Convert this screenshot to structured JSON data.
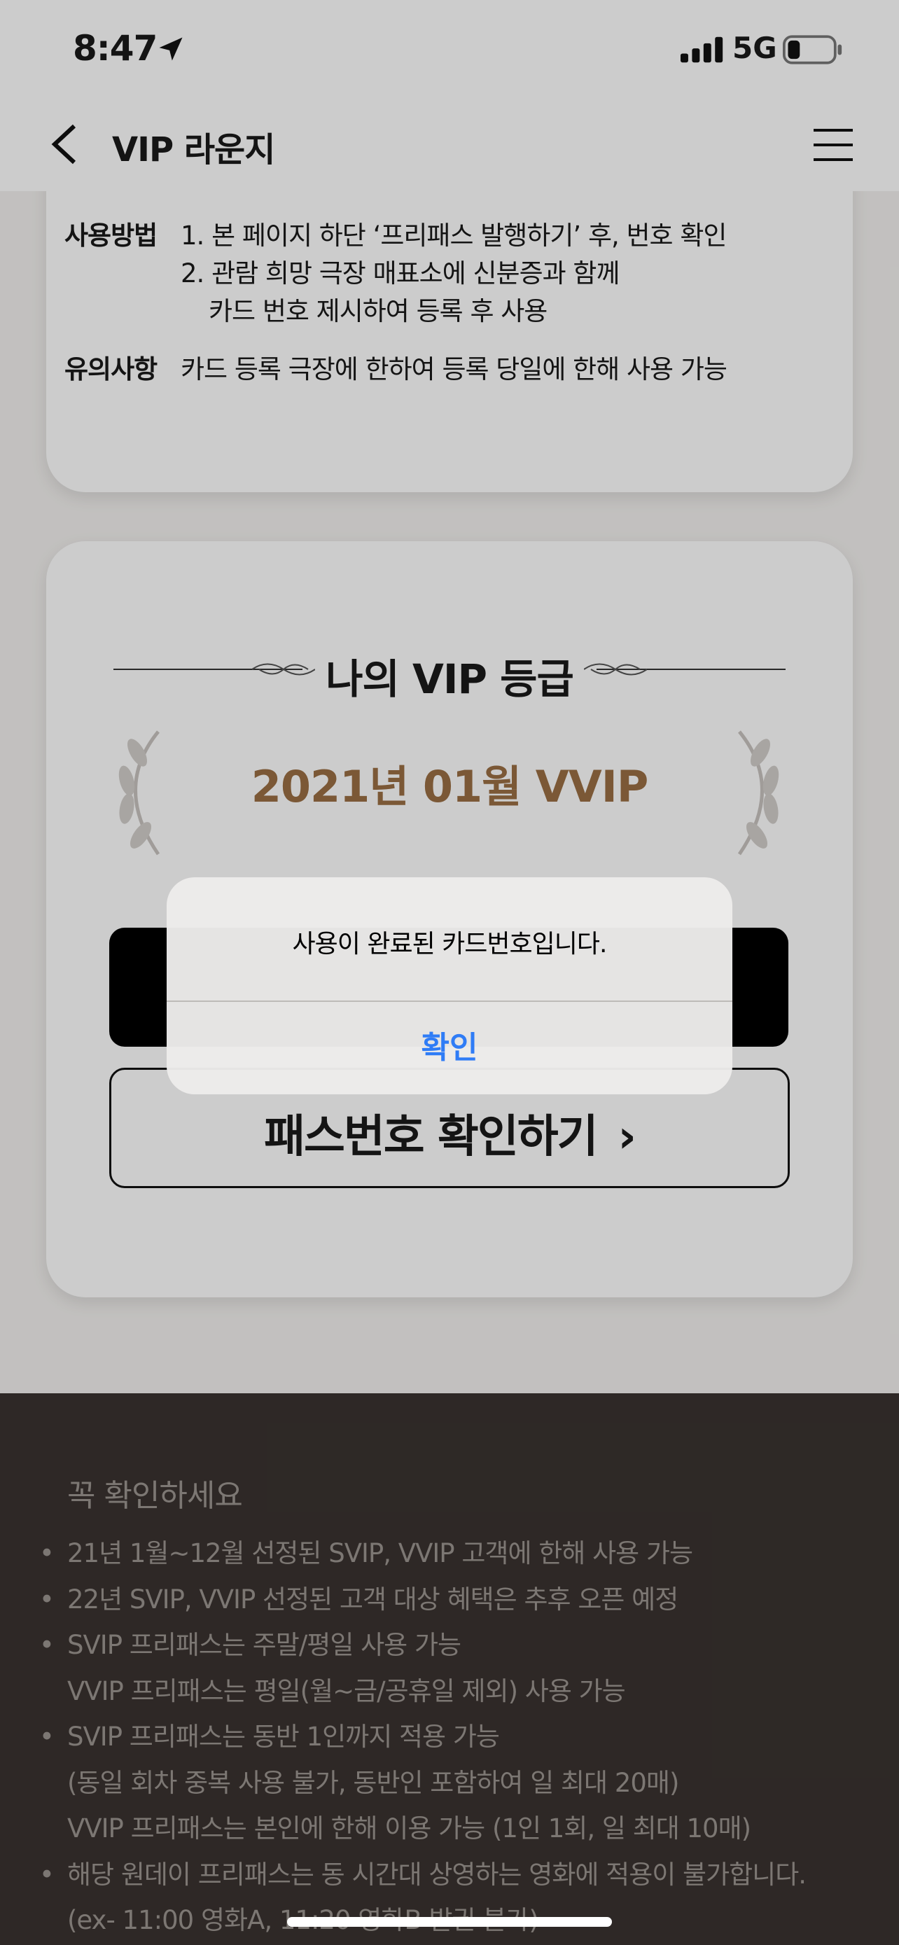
{
  "status_bar": {
    "time": "8:47",
    "network": "5G"
  },
  "nav": {
    "title": "VIP 라운지"
  },
  "usage": {
    "method_label": "사용방법",
    "method_lines": [
      "1. 본 페이지 하단 ‘프리패스 발행하기’ 후, 번호 확인",
      "2. 관람 희망 극장 매표소에 신분증과 함께",
      "    카드 번호 제시하여 등록 후 사용"
    ],
    "caution_label": "유의사항",
    "caution_text": "카드 등록 극장에 한하여 등록 당일에 한해 사용 가능"
  },
  "grade": {
    "title": "나의 VIP 등급",
    "value": "2021년 01월 VVIP",
    "check_button": "패스번호 확인하기",
    "check_chevron": "›"
  },
  "footer": {
    "title": "꼭 확인하세요",
    "items": [
      {
        "bullet": true,
        "text": "21년 1월~12월 선정된 SVIP, VVIP 고객에 한해 사용 가능"
      },
      {
        "bullet": true,
        "text": "22년 SVIP, VVIP 선정된 고객 대상 혜택은 추후 오픈 예정"
      },
      {
        "bullet": true,
        "text": "SVIP 프리패스는 주말/평일 사용 가능"
      },
      {
        "bullet": false,
        "text": "VVIP 프리패스는 평일(월~금/공휴일 제외) 사용 가능"
      },
      {
        "bullet": true,
        "text": "SVIP 프리패스는 동반 1인까지 적용 가능"
      },
      {
        "bullet": false,
        "text": "(동일 회차 중복 사용 불가, 동반인 포함하여 일 최대 20매)"
      },
      {
        "bullet": false,
        "text": "VVIP 프리패스는 본인에 한해 이용 가능 (1인 1회, 일 최대 10매)"
      },
      {
        "bullet": true,
        "text": "해당 원데이 프리패스는 동 시간대 상영하는 영화에 적용이 불가합니다."
      },
      {
        "bullet": false,
        "text": "(ex- 11:00 영화A, 11:20 영화B 발권 불가)"
      }
    ]
  },
  "alert": {
    "message": "사용이 완료된 카드번호입니다.",
    "confirm": "확인"
  },
  "colors": {
    "grade_gold": "#9a6f44",
    "alert_button": "#2f7cf6",
    "footer_bg": "#3a3330"
  },
  "icons": [
    "location-arrow-icon",
    "signal-icon",
    "battery-icon",
    "back-chevron-icon",
    "hamburger-menu-icon",
    "laurel-left-icon",
    "laurel-right-icon",
    "ornament-icon"
  ]
}
